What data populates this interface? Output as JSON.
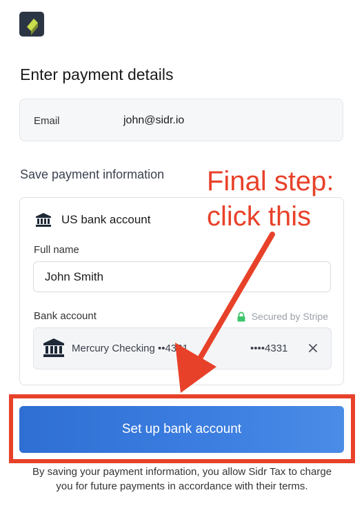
{
  "page": {
    "title": "Enter payment details"
  },
  "email": {
    "label": "Email",
    "value": "john@sidr.io"
  },
  "save_section": {
    "title": "Save payment information",
    "method_label": "US bank account",
    "full_name_label": "Full name",
    "full_name_value": "John Smith",
    "bank_account_label": "Bank account",
    "secured_label": "Secured by Stripe",
    "account_name": "Mercury Checking ••4331",
    "account_masked": "••••4331"
  },
  "cta": {
    "label": "Set up bank account"
  },
  "terms": {
    "text": "By saving your payment information, you allow Sidr Tax to charge you for future payments in accordance with their terms."
  },
  "annotation": {
    "line1": "Final step:",
    "line2": "click this"
  },
  "colors": {
    "accent_blue": "#3b7de0",
    "annotation_red": "#e8412a",
    "logo_bg": "#2b3544",
    "logo_green": "#c8de4c",
    "secure_green": "#3ec46d"
  },
  "icons": {
    "logo": "sidr-logo-icon",
    "bank": "bank-icon",
    "lock": "lock-icon",
    "remove": "close-icon"
  }
}
